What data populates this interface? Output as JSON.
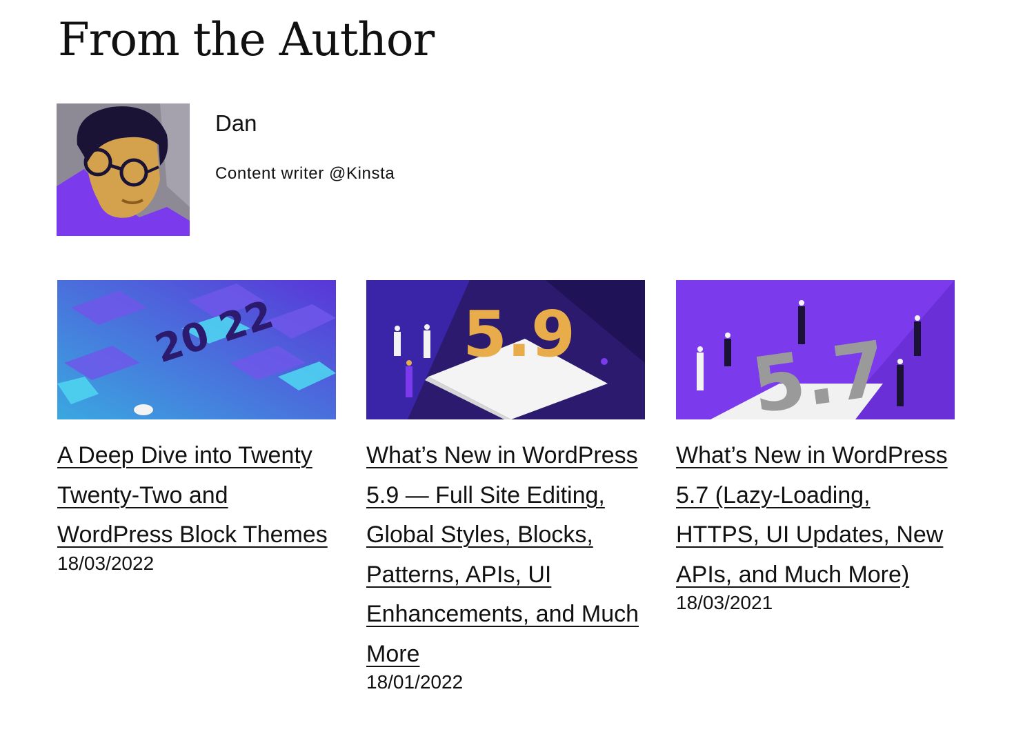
{
  "section": {
    "title": "From the Author"
  },
  "author": {
    "name": "Dan",
    "bio": "Content writer @Kinsta"
  },
  "posts": [
    {
      "title": "A Deep Dive into Twenty Twenty-Two and WordPress Block Themes",
      "date": "18/03/2022",
      "thumb_label": "20 22"
    },
    {
      "title": "What’s New in WordPress 5.9 — Full Site Editing, Global Styles, Blocks, Patterns, APIs, UI Enhancements, and Much More",
      "date": "18/01/2022",
      "thumb_label": "5.9"
    },
    {
      "title": "What’s New in WordPress 5.7 (Lazy-Loading, HTTPS, UI Updates, New APIs, and Much More)",
      "date": "18/03/2021",
      "thumb_label": "5.7"
    }
  ],
  "colors": {
    "brand_purple": "#7c3aed",
    "deep_purple": "#2b1a6e",
    "accent_orange": "#e8ad4a",
    "text": "#111111"
  }
}
